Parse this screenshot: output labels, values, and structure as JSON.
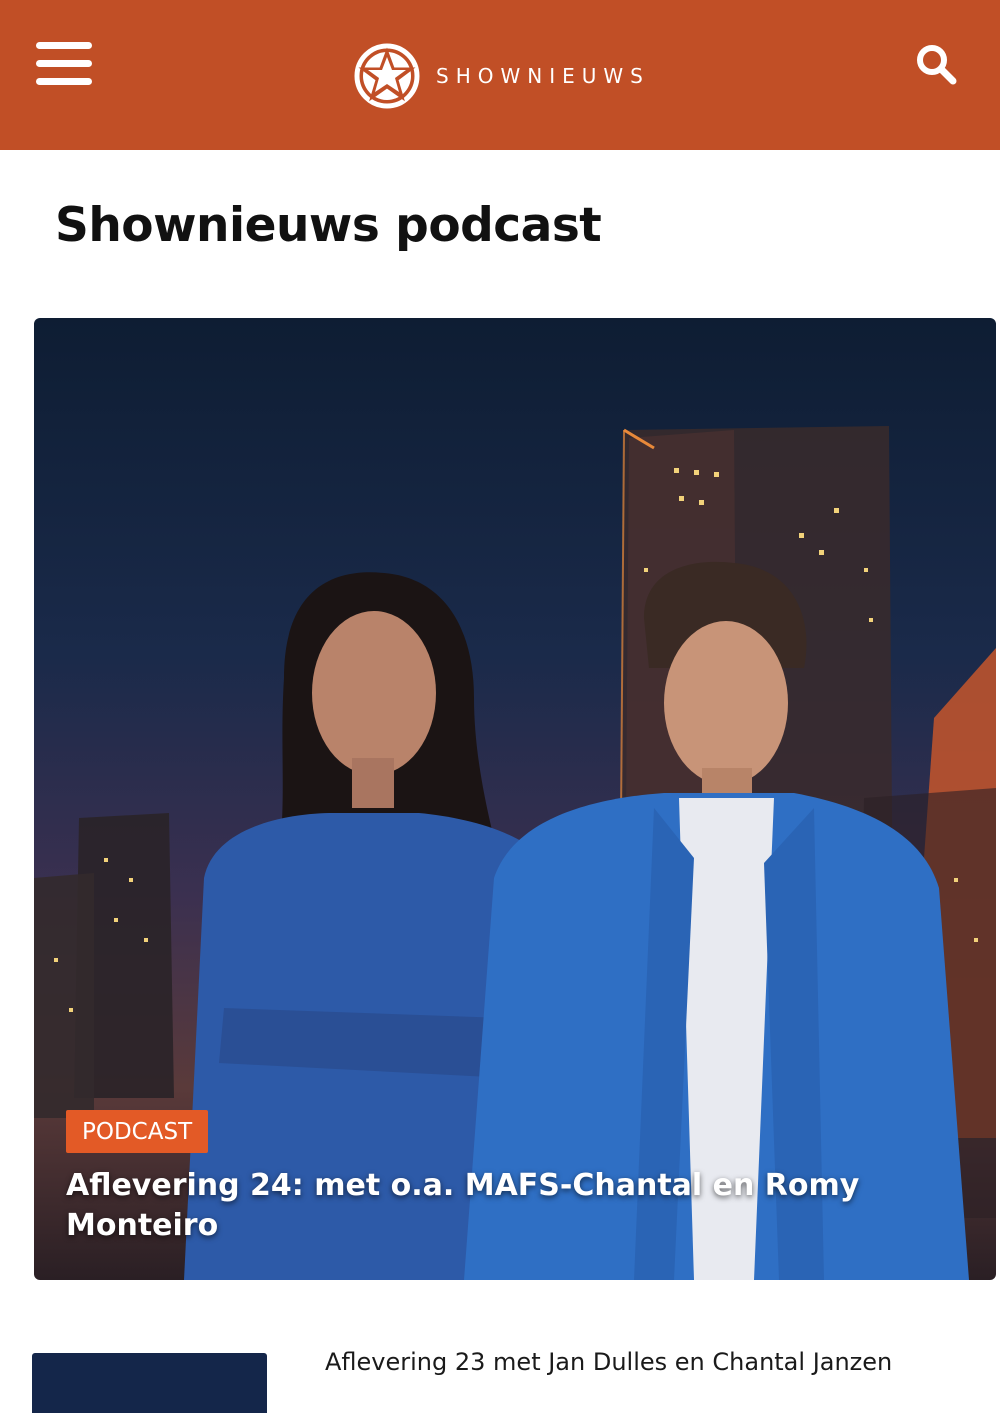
{
  "header": {
    "brand": "SHOWNIEUWS",
    "menu_icon": "hamburger-menu-icon",
    "search_icon": "search-icon",
    "logo_icon": "star-logo-icon",
    "background_color": "#c14f26"
  },
  "page": {
    "title": "Shownieuws podcast"
  },
  "hero": {
    "badge": "PODCAST",
    "badge_color": "#e35a26",
    "title": "Aflevering 24: met o.a. MAFS-Chantal en Romy Monteiro"
  },
  "list": {
    "items": [
      {
        "title": "Aflevering 23 met Jan Dulles en Chantal Janzen"
      }
    ]
  }
}
